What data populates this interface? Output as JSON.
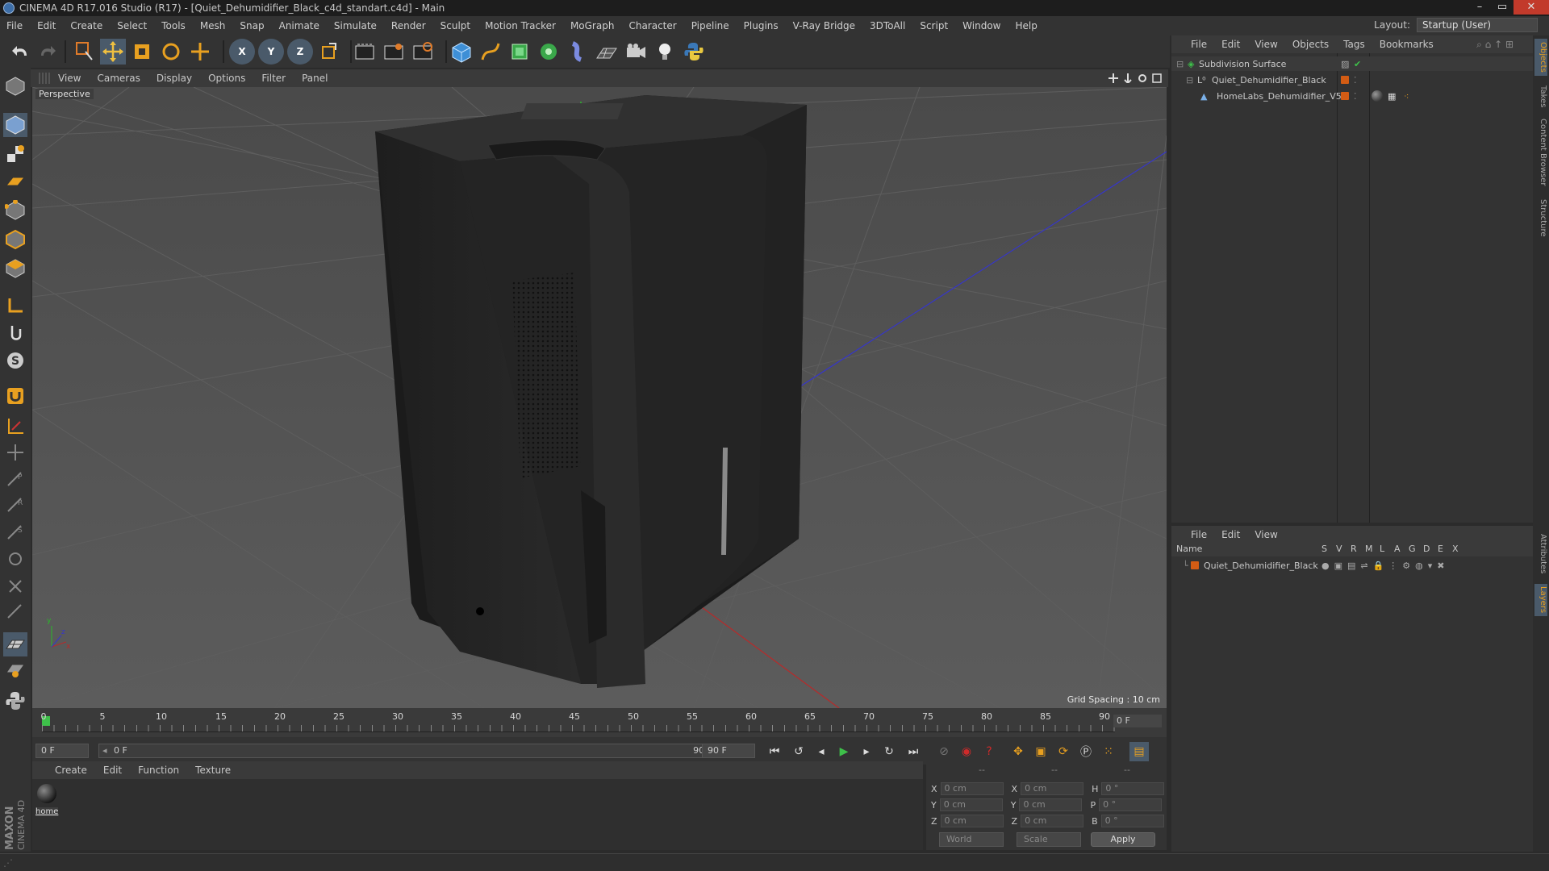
{
  "window": {
    "title": "CINEMA 4D R17.016 Studio (R17) - [Quiet_Dehumidifier_Black_c4d_standart.c4d] - Main",
    "controls": [
      "–",
      "▭",
      "✕"
    ]
  },
  "menubar": [
    "File",
    "Edit",
    "Create",
    "Select",
    "Tools",
    "Mesh",
    "Snap",
    "Animate",
    "Simulate",
    "Render",
    "Sculpt",
    "Motion Tracker",
    "MoGraph",
    "Character",
    "Pipeline",
    "Plugins",
    "V-Ray Bridge",
    "3DToAll",
    "Script",
    "Window",
    "Help"
  ],
  "layout": {
    "label": "Layout:",
    "value": "Startup (User)"
  },
  "toolbar": {
    "axis_x": "X",
    "axis_y": "Y",
    "axis_z": "Z"
  },
  "viewport": {
    "menu": [
      "View",
      "Cameras",
      "Display",
      "Options",
      "Filter",
      "Panel"
    ],
    "label": "Perspective",
    "grid_spacing": "Grid Spacing : 10 cm"
  },
  "timeline": {
    "ticks": [
      "0",
      "5",
      "10",
      "15",
      "20",
      "25",
      "30",
      "35",
      "40",
      "45",
      "50",
      "55",
      "60",
      "65",
      "70",
      "75",
      "80",
      "85",
      "90"
    ],
    "current_frame": "0 F"
  },
  "transport": {
    "start_field": "0 F",
    "range_start": "0 F",
    "range_end": "90 F",
    "end_field": "90 F"
  },
  "material_manager": {
    "menu": [
      "Create",
      "Edit",
      "Function",
      "Texture"
    ],
    "material_name": "home"
  },
  "coordinates": {
    "head": [
      "--",
      "--",
      "--"
    ],
    "rows": [
      {
        "a": "X",
        "av": "0 cm",
        "b": "X",
        "bv": "0 cm",
        "c": "H",
        "cv": "0 °"
      },
      {
        "a": "Y",
        "av": "0 cm",
        "b": "Y",
        "bv": "0 cm",
        "c": "P",
        "cv": "0 °"
      },
      {
        "a": "Z",
        "av": "0 cm",
        "b": "Z",
        "bv": "0 cm",
        "c": "B",
        "cv": "0 °"
      }
    ],
    "mode1": "World",
    "mode2": "Scale",
    "apply": "Apply"
  },
  "object_manager": {
    "menu": [
      "File",
      "Edit",
      "View",
      "Objects",
      "Tags",
      "Bookmarks"
    ],
    "objects": [
      {
        "name": "Subdivision Surface"
      },
      {
        "name": "Quiet_Dehumidifier_Black"
      },
      {
        "name": "HomeLabs_Dehumidifier_V5"
      }
    ]
  },
  "layer_manager": {
    "menu": [
      "File",
      "Edit",
      "View"
    ],
    "columns": [
      "Name",
      "S",
      "V",
      "R",
      "M",
      "L",
      "A",
      "G",
      "D",
      "E",
      "X"
    ],
    "layers": [
      {
        "name": "Quiet_Dehumidifier_Black"
      }
    ]
  },
  "right_tabs": [
    "Objects",
    "Takes",
    "Content Browser",
    "Structure",
    "Attributes",
    "Layers"
  ],
  "branding": {
    "line1": "MAXON",
    "line2": "CINEMA 4D"
  },
  "colors": {
    "accent_orange": "#d35c14",
    "panel_bg": "#333333",
    "viewport_bg": "#525252"
  }
}
